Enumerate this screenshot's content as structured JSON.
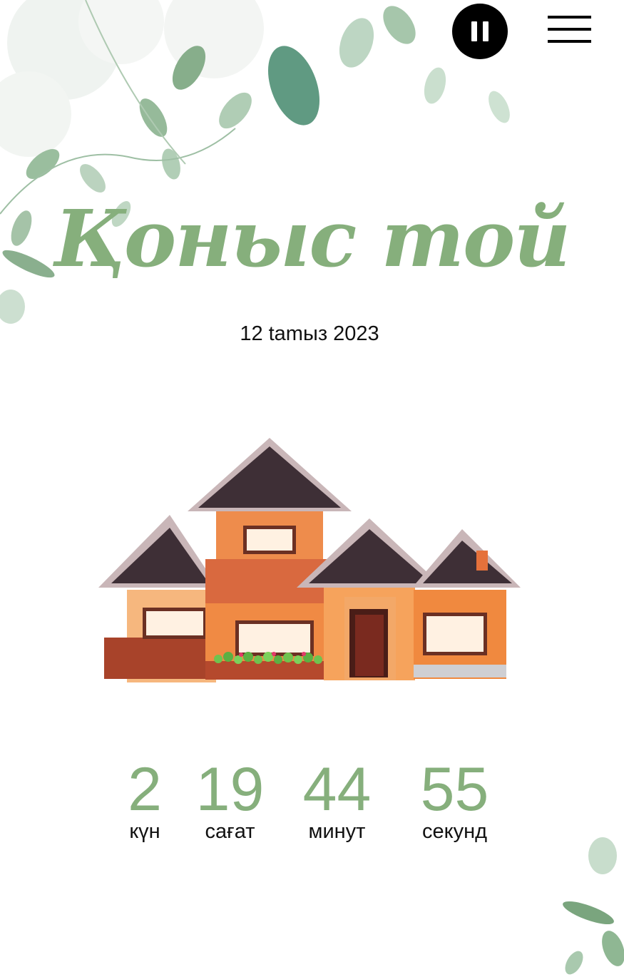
{
  "header": {
    "pause_icon": "pause-icon",
    "menu_icon": "hamburger-menu-icon"
  },
  "invitation": {
    "title": "Қоныс той",
    "date": "12 tamыз 2023"
  },
  "countdown": [
    {
      "value": "2",
      "label": "күн"
    },
    {
      "value": "19",
      "label": "сағат"
    },
    {
      "value": "44",
      "label": "минут"
    },
    {
      "value": "55",
      "label": "секунд"
    }
  ],
  "colors": {
    "accent_green": "#86AF7C",
    "text": "#111111",
    "button_bg": "#000000"
  }
}
